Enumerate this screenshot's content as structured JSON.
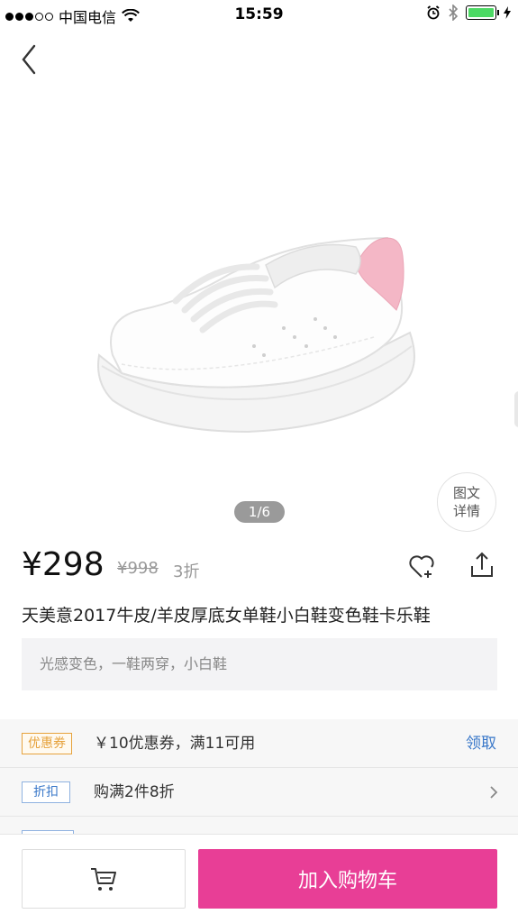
{
  "status_bar": {
    "carrier": "中国电信",
    "time": "15:59"
  },
  "gallery": {
    "indicator": "1/6",
    "detail_line1": "图文",
    "detail_line2": "详情"
  },
  "product": {
    "price": "¥298",
    "original_price": "¥998",
    "discount": "3折",
    "title": "天美意2017牛皮/羊皮厚底女单鞋小白鞋变色鞋卡乐鞋",
    "subtitle": "光感变色，一鞋两穿，小白鞋"
  },
  "promotions": [
    {
      "tag": "优惠券",
      "text": "￥10优惠券，满11可用",
      "action": "领取"
    },
    {
      "tag": "折扣",
      "text": "购满2件8折",
      "action": ""
    }
  ],
  "bottom_bar": {
    "add_to_cart": "加入购物车"
  },
  "colors": {
    "accent": "#e83e96",
    "link": "#3a78c9",
    "coupon": "#e6a23c",
    "battery": "#4cd964"
  }
}
